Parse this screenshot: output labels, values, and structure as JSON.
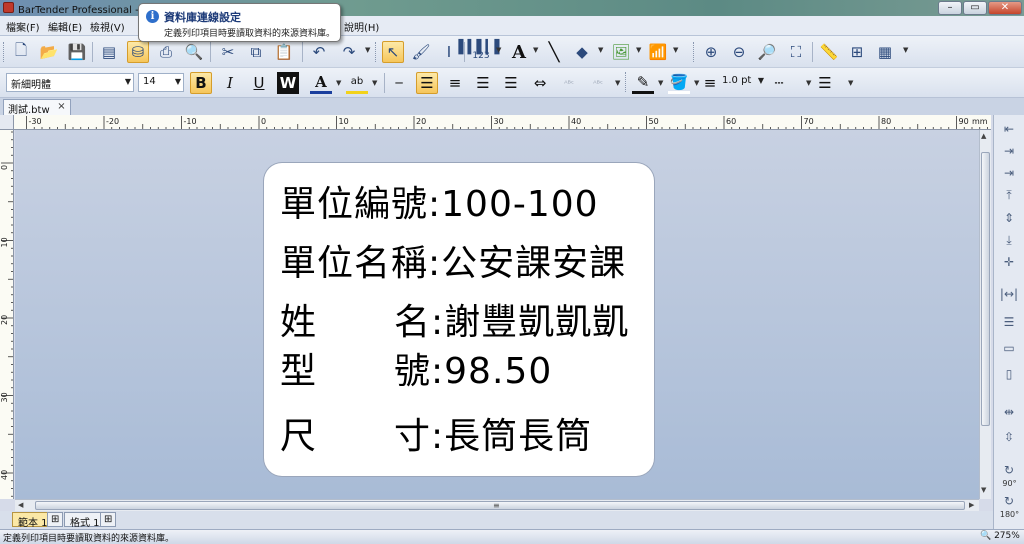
{
  "app": {
    "title": "BarTender Professional - [測試.btw]"
  },
  "menu": {
    "items": [
      "檔案(F)",
      "編輯(E)",
      "檢視(V)",
      "說明(H)"
    ]
  },
  "tooltip": {
    "title": "資料庫連線設定",
    "text": "定義列印項目時要讀取資料的來源資料庫。"
  },
  "format_bar": {
    "font": "新細明體",
    "size": "14",
    "line_width": "1.0 pt",
    "bold": "B",
    "italic": "I",
    "underline": "U",
    "wordart": "W",
    "text_color": "A",
    "highlight": "ab"
  },
  "toolbar": {
    "barcode_label": "123",
    "text_tool": "A"
  },
  "document": {
    "tab_label": "測試.btw",
    "close": "×"
  },
  "ruler": {
    "unit": "mm",
    "h_labels": [
      "-30",
      "-20",
      "-10",
      "0",
      "10",
      "20",
      "30",
      "40",
      "50",
      "60",
      "70",
      "80",
      "90"
    ],
    "v_labels": [
      "0",
      "10",
      "20",
      "30",
      "40"
    ]
  },
  "label": {
    "rows": [
      {
        "key": "單位編號",
        "value": "100-100"
      },
      {
        "key": "單位名稱",
        "value": "公安課安課"
      },
      {
        "key1": "姓",
        "key2": "名",
        "value": "謝豐凱凱凱"
      },
      {
        "key1": "型",
        "key2": "號",
        "value": "98.50"
      },
      {
        "key1": "尺",
        "key2": "寸",
        "value": "長筒長筒"
      }
    ],
    "colon": ":"
  },
  "right_palette": {
    "rotate_90": "90°",
    "rotate_180": "180°"
  },
  "page_tabs": [
    "範本 1",
    "格式 1"
  ],
  "status": {
    "message": "定義列印項目時要讀取資料的來源資料庫。",
    "zoom": "275%"
  },
  "colors": {
    "accent": "#f6c65b",
    "canvas_top": "#c8d1e2",
    "canvas_bottom": "#a8bbd6"
  }
}
